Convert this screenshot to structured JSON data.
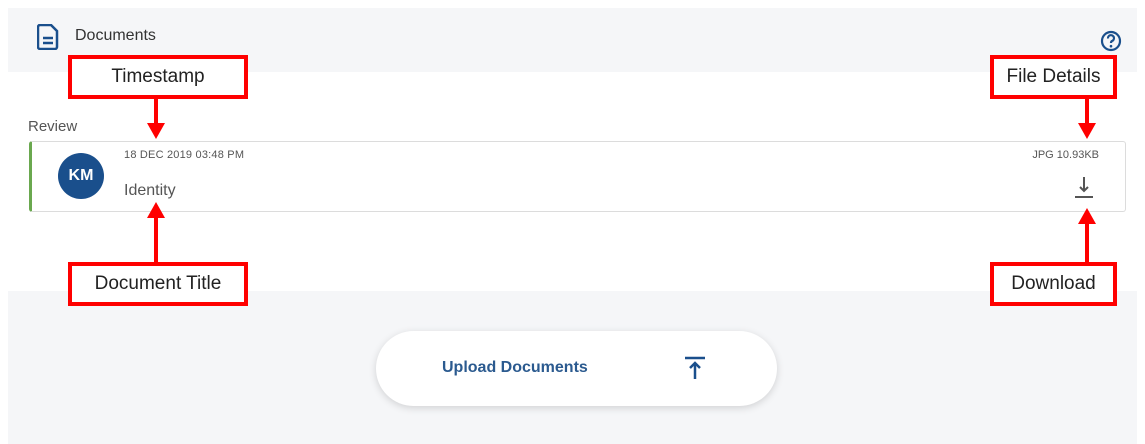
{
  "header": {
    "title": "Documents",
    "icon": "document-icon",
    "help_icon": "help-icon"
  },
  "section": {
    "label": "Review"
  },
  "document": {
    "avatar_initials": "KM",
    "avatar_color": "#1a4f8c",
    "timestamp": "18 DEC 2019 03:48 PM",
    "title": "Identity",
    "file_details": "JPG 10.93KB",
    "status_color": "#6aa84f",
    "download_icon": "download-icon"
  },
  "upload": {
    "label": "Upload Documents",
    "icon": "upload-icon",
    "accent": "#2b5a8f"
  },
  "annotations": {
    "timestamp": "Timestamp",
    "file_details": "File Details",
    "document_title": "Document Title",
    "download": "Download",
    "color": "#ff0000"
  }
}
